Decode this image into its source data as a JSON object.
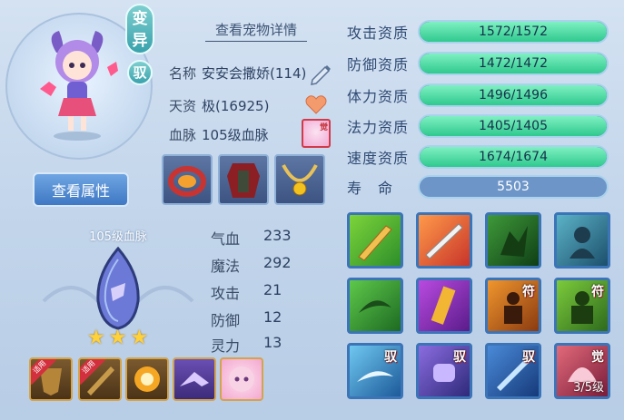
{
  "pet": {
    "tag_mutate": "变异",
    "tag_ride": "驭",
    "view_attributes": "查看属性",
    "view_details": "查看宠物详情",
    "name_label": "名称",
    "name_value": "安安会撒娇(114)",
    "talent_label": "天资",
    "talent_value": "极(16925)",
    "bloodline_label": "血脉",
    "bloodline_value": "105级血脉",
    "blood_icon_text": "觉"
  },
  "equipment": [
    {
      "name": "ring-equipment"
    },
    {
      "name": "armor-equipment"
    },
    {
      "name": "necklace-equipment"
    }
  ],
  "bloodline": {
    "title": "105级血脉",
    "stars": 3
  },
  "stats": [
    {
      "label": "气血",
      "value": "233"
    },
    {
      "label": "魔法",
      "value": "292"
    },
    {
      "label": "攻击",
      "value": "21"
    },
    {
      "label": "防御",
      "value": "12"
    },
    {
      "label": "灵力",
      "value": "13"
    }
  ],
  "slots": [
    {
      "badge": "适用"
    },
    {
      "badge": "适用"
    },
    {
      "badge": ""
    },
    {
      "badge": ""
    },
    {
      "badge": ""
    }
  ],
  "aptitudes": [
    {
      "label": "攻击资质",
      "text": "1572/1572",
      "fraction": 1.0
    },
    {
      "label": "防御资质",
      "text": "1472/1472",
      "fraction": 1.0
    },
    {
      "label": "体力资质",
      "text": "1496/1496",
      "fraction": 1.0
    },
    {
      "label": "法力资质",
      "text": "1405/1405",
      "fraction": 1.0
    },
    {
      "label": "速度资质",
      "text": "1674/1674",
      "fraction": 1.0
    }
  ],
  "lifespan": {
    "label": "寿　命",
    "value": "5503"
  },
  "skills": [
    {
      "tag": "",
      "count": ""
    },
    {
      "tag": "",
      "count": ""
    },
    {
      "tag": "",
      "count": ""
    },
    {
      "tag": "",
      "count": ""
    },
    {
      "tag": "",
      "count": ""
    },
    {
      "tag": "",
      "count": ""
    },
    {
      "tag": "符",
      "count": ""
    },
    {
      "tag": "符",
      "count": ""
    },
    {
      "tag": "驭",
      "count": ""
    },
    {
      "tag": "驭",
      "count": ""
    },
    {
      "tag": "驭",
      "count": ""
    },
    {
      "tag": "觉",
      "count": "3/5级"
    }
  ],
  "colors": {
    "aptitude_fill": "#2fc98e",
    "accent_blue": "#3f78c4",
    "panel_bg": "#c3d5ea"
  }
}
